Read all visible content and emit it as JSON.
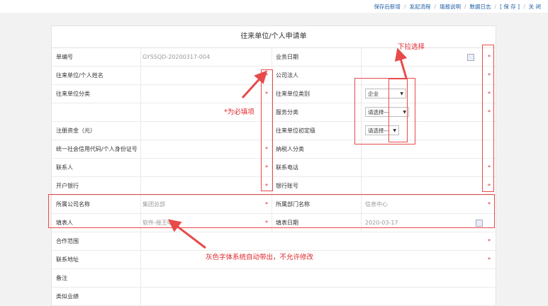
{
  "toolbar": {
    "items": [
      "保存后新增",
      "发起流程",
      "填报说明",
      "数据日志",
      "[ 保 存 ]",
      "关 闭"
    ]
  },
  "form": {
    "title": "往来单位/个人申请单",
    "rows": [
      {
        "l1": "单编号",
        "v1": "GYSSQD-20200317-004",
        "l2": "业务日期",
        "v2": ""
      },
      {
        "l1": "往来单位/个人姓名",
        "v1": "",
        "l2": "公司法人",
        "v2": ""
      },
      {
        "l1": "往来单位分类",
        "v1": "",
        "l2": "往来单位类别",
        "v2": "企业"
      },
      {
        "l1": "",
        "v1": "",
        "l2": "服务分类",
        "v2": "请选择---"
      },
      {
        "l1": "注册资金（元）",
        "v1": "",
        "l2": "往来单位初定级",
        "v2": "请选择---"
      },
      {
        "l1": "统一社会信用代码/个人身份证号",
        "v1": "",
        "l2": "纳税人分类",
        "v2": ""
      },
      {
        "l1": "联系人",
        "v1": "",
        "l2": "联系电话",
        "v2": ""
      },
      {
        "l1": "开户银行",
        "v1": "",
        "l2": "银行账号",
        "v2": ""
      },
      {
        "l1": "所属公司名称",
        "v1": "集团总部",
        "l2": "所属部门名称",
        "v2": "信息中心"
      },
      {
        "l1": "填表人",
        "v1": "软件-接王明",
        "l2": "填表日期",
        "v2": "2020-03-17"
      },
      {
        "l1": "合作范围",
        "v1": "",
        "l2": "",
        "v2": ""
      },
      {
        "l1": "联系地址",
        "v1": "",
        "l2": "",
        "v2": ""
      },
      {
        "l1": "备注",
        "v1": "",
        "l2": "",
        "v2": ""
      },
      {
        "l1": "类似业绩",
        "v1": "",
        "l2": "",
        "v2": ""
      }
    ],
    "required_mark": "*"
  },
  "annotations": {
    "dropdown_note": "下拉选择",
    "required_note": "*为必填项",
    "auto_note": "灰色字体系统自动带出，不允许修改"
  },
  "colors": {
    "link": "#1f5fa6",
    "annotation": "#e0262a"
  }
}
